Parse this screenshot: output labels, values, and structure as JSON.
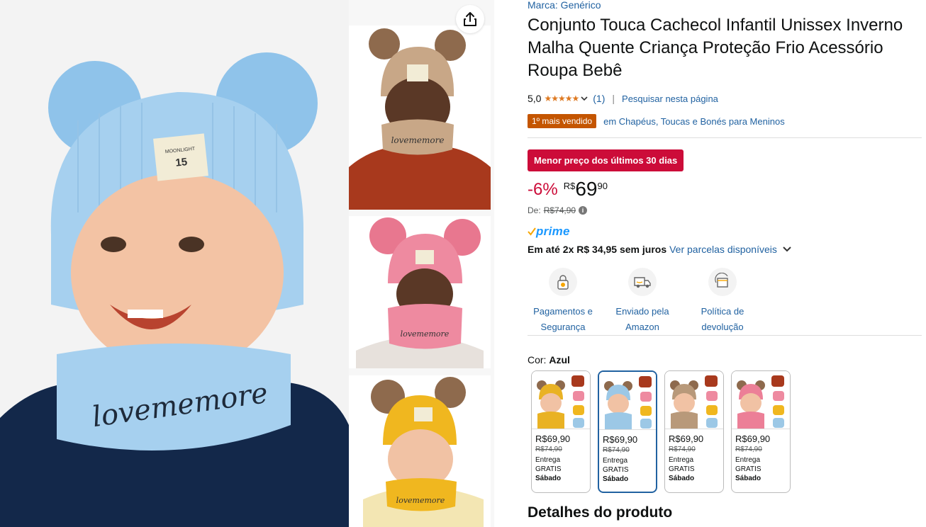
{
  "product": {
    "brand": "Marca: Genérico",
    "title": "Conjunto Touca Cachecol Infantil Unissex Inverno Malha Quente Criança Proteção Frio Acessório Roupa Bebê",
    "rating": "5,0",
    "stars": "★★★★★",
    "rating_count": "(1)",
    "separator": "|",
    "search_link": "Pesquisar nesta página",
    "bestseller_badge": "1º mais vendido",
    "bestseller_category": "em Chapéus, Toucas e Bonés para Meninos"
  },
  "pricing": {
    "deal_badge": "Menor preço dos últimos 30 dias",
    "discount": "-6%",
    "currency": "R$",
    "whole": "69",
    "fraction": "90",
    "was_label": "De:",
    "was_price": "R$74,90",
    "info_icon": "i",
    "prime_label": "prime",
    "installments_text": "Em até 2x R$ 34,95 sem juros",
    "installments_link": "Ver parcelas disponíveis"
  },
  "features": [
    {
      "icon": "lock-payment-icon",
      "label_line1": "Pagamentos e",
      "label_line2": "Segurança"
    },
    {
      "icon": "truck-icon",
      "label_line1": "Enviado pela",
      "label_line2": "Amazon"
    },
    {
      "icon": "return-box-icon",
      "label_line1": "Política de",
      "label_line2": "devolução"
    }
  ],
  "color": {
    "label": "Cor:",
    "selected": "Azul"
  },
  "swatches": [
    {
      "price": "R$69,90",
      "was": "R$74,90",
      "ship": "Entrega",
      "ship2": "GRATIS",
      "day": "Sábado",
      "hat_color": "#e9b224",
      "selected": false
    },
    {
      "price": "R$69,90",
      "was": "R$74,90",
      "ship": "Entrega",
      "ship2": "GRATIS",
      "day": "Sábado",
      "hat_color": "#9cc8e6",
      "selected": true
    },
    {
      "price": "R$69,90",
      "was": "R$74,90",
      "ship": "Entrega",
      "ship2": "GRATIS",
      "day": "Sábado",
      "hat_color": "#b8997a",
      "selected": false
    },
    {
      "price": "R$69,90",
      "was": "R$74,90",
      "ship": "Entrega",
      "ship2": "GRATIS",
      "day": "Sábado",
      "hat_color": "#ec7f97",
      "selected": false
    }
  ],
  "details_heading": "Detalhes do produto",
  "image_text": {
    "scarf": "lovememore",
    "patch_line1": "MOONLIGHT",
    "patch_number": "15"
  },
  "colors": {
    "link": "#2162a1",
    "deal": "#cc0c39",
    "badge": "#c45500",
    "star": "#de7921",
    "prime": "#1a98ff"
  }
}
